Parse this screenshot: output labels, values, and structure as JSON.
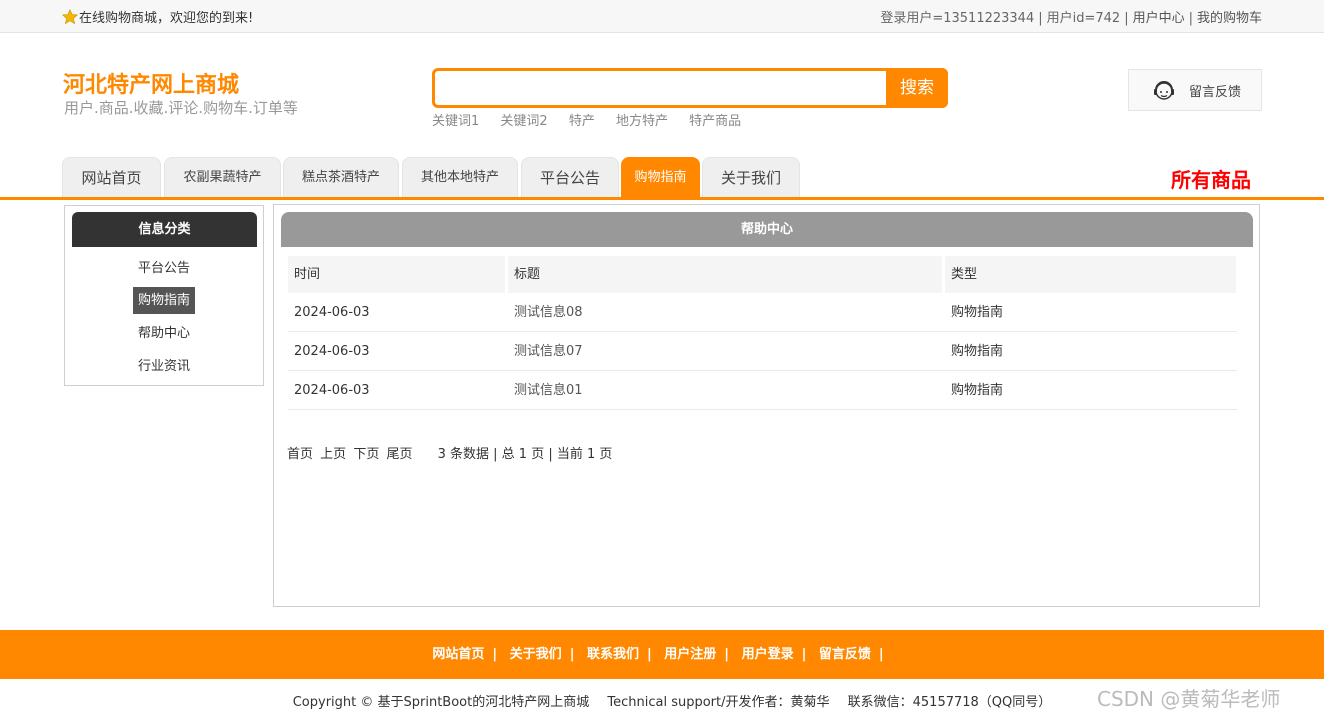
{
  "topbar": {
    "welcome": "在线购物商城，欢迎您的到来!",
    "login_user": "登录用户=13511223344",
    "user_id": "用户id=742",
    "user_center": "用户中心",
    "my_cart": "我的购物车"
  },
  "header": {
    "site_title": "河北特产网上商城",
    "site_subtitle": "用户.商品.收藏.评论.购物车.订单等",
    "search": {
      "value": "",
      "placeholder": "",
      "button": "搜索",
      "keywords": [
        "关键词1",
        "关键词2",
        "特产",
        "地方特产",
        "特产商品"
      ]
    },
    "feedback_label": "留言反馈"
  },
  "nav": {
    "tabs": [
      {
        "label": "网站首页",
        "active": false
      },
      {
        "label": "农副果蔬特产",
        "active": false
      },
      {
        "label": "糕点茶酒特产",
        "active": false
      },
      {
        "label": "其他本地特产",
        "active": false
      },
      {
        "label": "平台公告",
        "active": false
      },
      {
        "label": "购物指南",
        "active": true
      },
      {
        "label": "关于我们",
        "active": false
      }
    ],
    "all_goods": "所有商品"
  },
  "sidebar": {
    "title": "信息分类",
    "items": [
      {
        "label": "平台公告",
        "active": false
      },
      {
        "label": "购物指南",
        "active": true
      },
      {
        "label": "帮助中心",
        "active": false
      },
      {
        "label": "行业资讯",
        "active": false
      }
    ]
  },
  "main": {
    "title": "帮助中心",
    "columns": [
      "时间",
      "标题",
      "类型"
    ],
    "rows": [
      {
        "date": "2024-06-03",
        "title": "测试信息08",
        "type": "购物指南"
      },
      {
        "date": "2024-06-03",
        "title": "测试信息07",
        "type": "购物指南"
      },
      {
        "date": "2024-06-03",
        "title": "测试信息01",
        "type": "购物指南"
      }
    ],
    "pager": {
      "first": "首页",
      "prev": "上页",
      "next": "下页",
      "last": "尾页",
      "stats": "3 条数据 | 总 1 页 | 当前 1 页"
    }
  },
  "footer": {
    "links": [
      "网站首页",
      "关于我们",
      "联系我们",
      "用户注册",
      "用户登录",
      "留言反馈"
    ],
    "copyright": "Copyright © 基于SprintBoot的河北特产网上商城",
    "support": "Technical support/开发作者：黄菊华",
    "contact": "联系微信：45157718（QQ同号）"
  },
  "watermark": "CSDN @黄菊华老师",
  "colors": {
    "accent": "#ff8800",
    "all_goods": "#ff0000",
    "sidebar_head": "#333333",
    "panel_head": "#999999"
  }
}
